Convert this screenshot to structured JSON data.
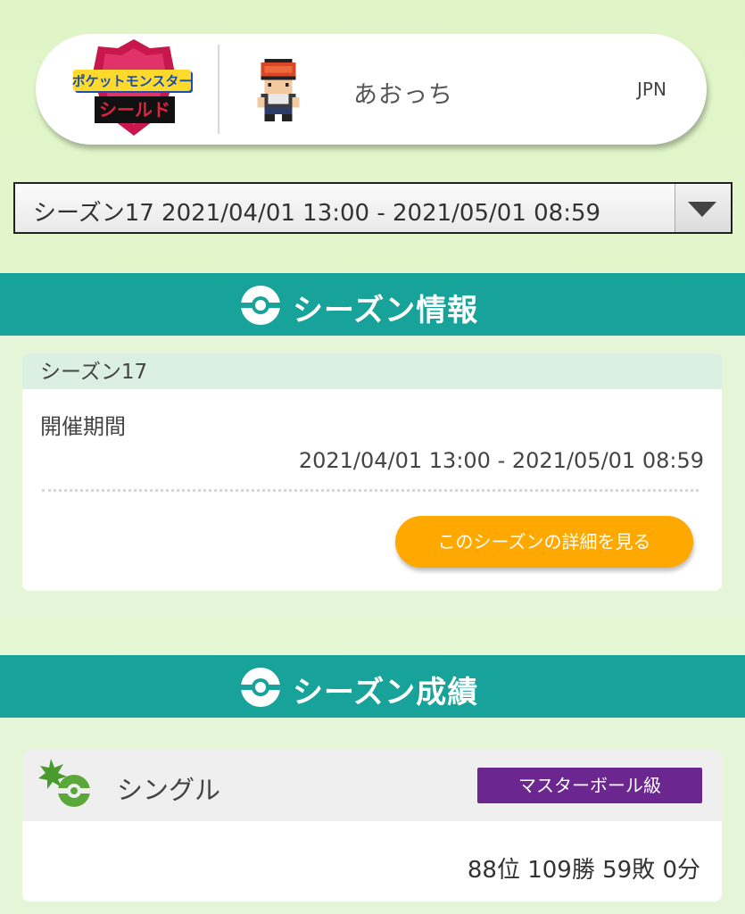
{
  "profile": {
    "game_logo_text": "ポケットモンスター シールド",
    "player_name": "あおっち",
    "region": "JPN"
  },
  "season_select": {
    "selected": "シーズン17 2021/04/01 13:00 - 2021/05/01 08:59"
  },
  "season_info": {
    "header": "シーズン情報",
    "season_name": "シーズン17",
    "period_label": "開催期間",
    "period_value": "2021/04/01 13:00 - 2021/05/01 08:59",
    "detail_button": "このシーズンの詳細を見る"
  },
  "season_results": {
    "header": "シーズン成績",
    "battle_mode": "シングル",
    "rank_class": "マスターボール級",
    "record": "88位 109勝 59敗 0分"
  },
  "colors": {
    "teal": "#17a39a",
    "orange_button": "#ffa800",
    "master_ball_purple": "#6c2690"
  }
}
